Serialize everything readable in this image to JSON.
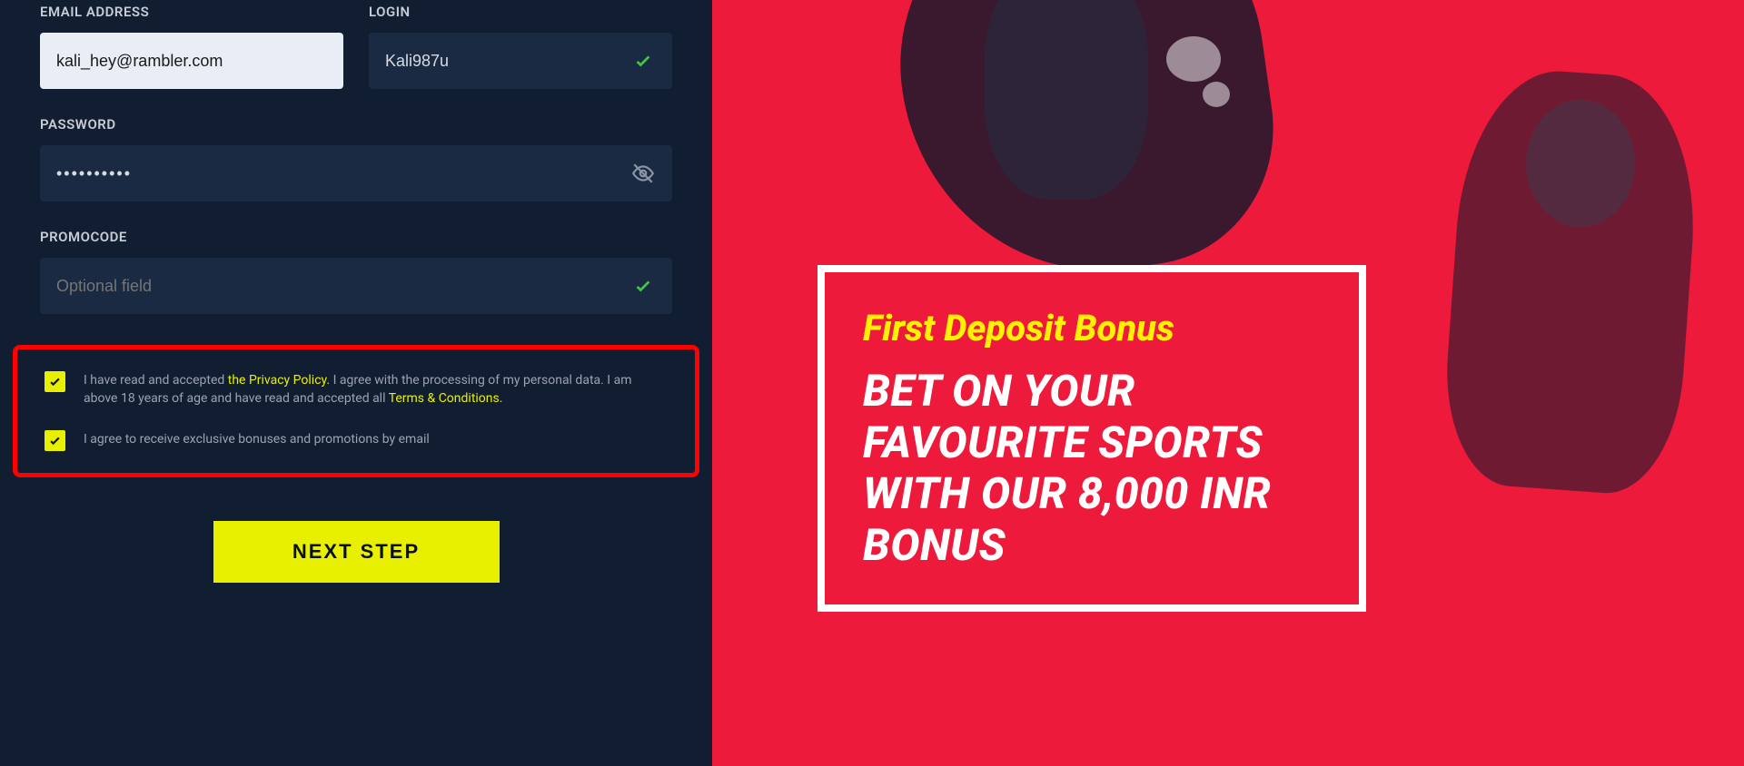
{
  "form": {
    "email_label": "EMAIL ADDRESS",
    "email_value": "kali_hey@rambler.com",
    "login_label": "LOGIN",
    "login_value": "Kali987u",
    "password_label": "PASSWORD",
    "password_value": "••••••••••",
    "promo_label": "PROMOCODE",
    "promo_placeholder": "Optional field",
    "terms_prefix": "I have read and accepted ",
    "terms_privacy": "the Privacy Policy.",
    "terms_mid": " I agree with the processing of my personal data. I am above 18 years of age and have read and accepted all ",
    "terms_tc": "Terms & Conditions.",
    "marketing": "I agree to receive exclusive bonuses and promotions by email",
    "next_btn": "NEXT STEP"
  },
  "promo": {
    "subtitle": "First Deposit Bonus",
    "headline": "BET ON YOUR FAVOURITE SPORTS WITH OUR 8,000 INR BONUS"
  }
}
